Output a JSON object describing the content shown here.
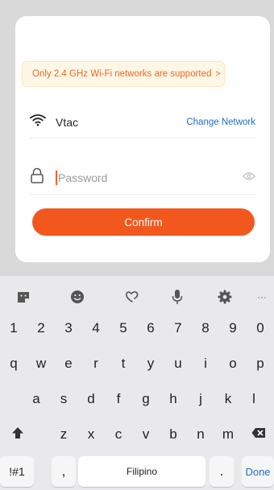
{
  "notice": {
    "text": "Only 2.4 GHz Wi-Fi networks are supported",
    "chevron": ">"
  },
  "network": {
    "ssid": "Vtac",
    "change_label": "Change Network"
  },
  "password": {
    "placeholder": "Password"
  },
  "confirm_label": "Confirm",
  "keyboard": {
    "toolbar_icons": [
      "sticker-icon",
      "emoji-icon",
      "heart-doodle-icon",
      "microphone-icon",
      "gear-icon",
      "more-icon"
    ],
    "more_label": "···",
    "numbers": [
      "1",
      "2",
      "3",
      "4",
      "5",
      "6",
      "7",
      "8",
      "9",
      "0"
    ],
    "row1": [
      "q",
      "w",
      "e",
      "r",
      "t",
      "y",
      "u",
      "i",
      "o",
      "p"
    ],
    "row2": [
      "a",
      "s",
      "d",
      "f",
      "g",
      "h",
      "j",
      "k",
      "l"
    ],
    "row3": [
      "z",
      "x",
      "c",
      "v",
      "b",
      "n",
      "m"
    ],
    "symbols_label": "!#1",
    "comma_label": ",",
    "space_label": "Filipino",
    "period_label": ".",
    "done_label": "Done"
  },
  "colors": {
    "accent": "#f2581e",
    "link": "#1e6ec8",
    "notice_bg": "#fff7e6"
  }
}
